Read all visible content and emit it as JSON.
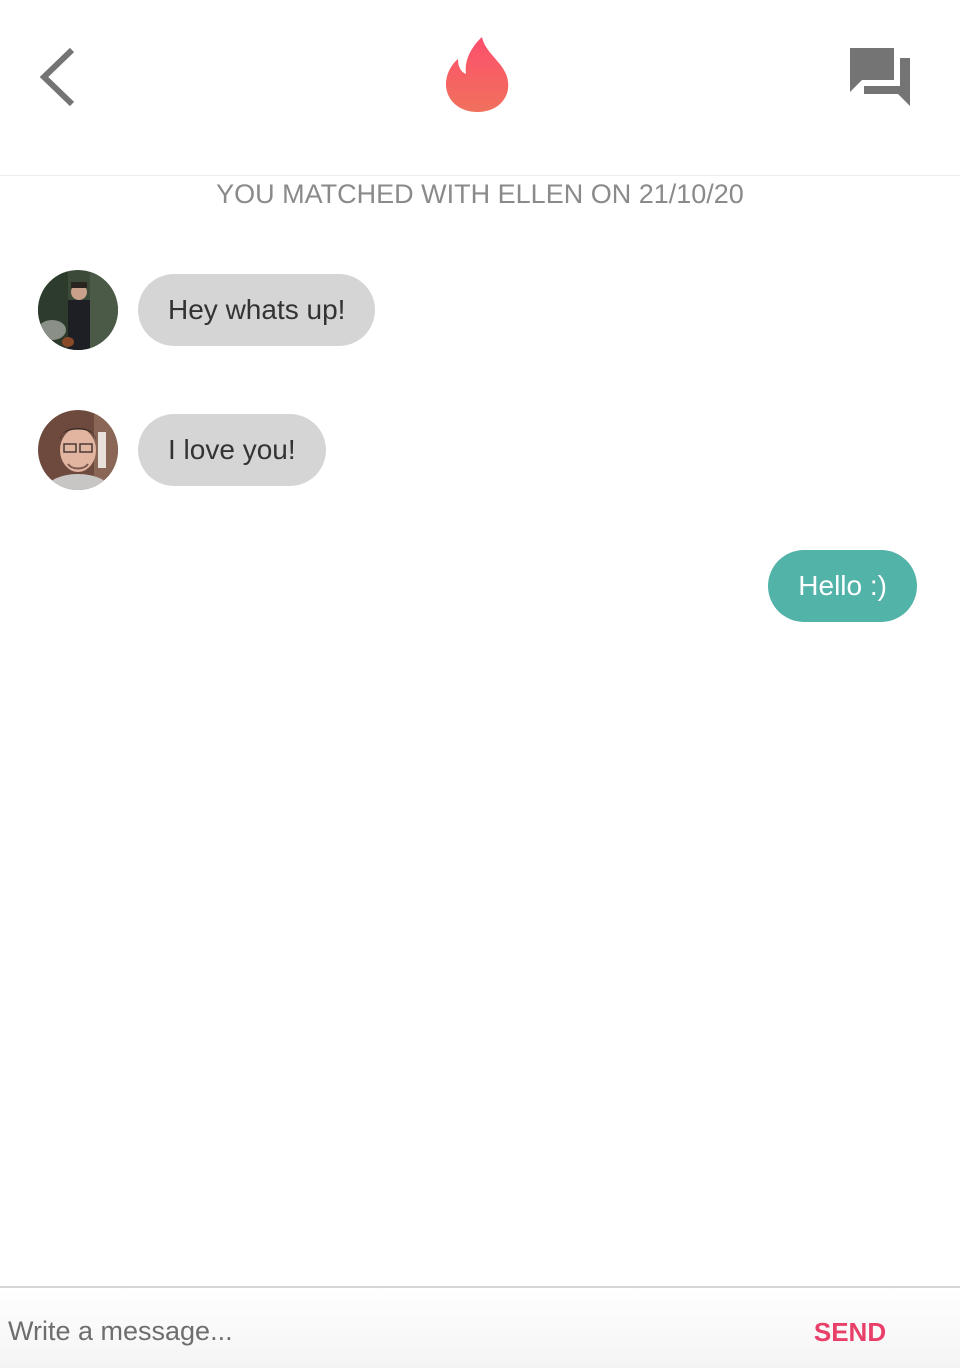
{
  "header": {
    "back_icon": "chevron-left-icon",
    "logo_icon": "flame-icon",
    "chats_icon": "chat-bubbles-icon",
    "colors": {
      "icon_gray": "#747474",
      "flame_top": "#fd5564",
      "flame_bottom": "#ef6b5a"
    }
  },
  "match_banner": "YOU MATCHED WITH ELLEN ON 21/10/20",
  "messages": [
    {
      "direction": "incoming",
      "text": "Hey whats up!"
    },
    {
      "direction": "incoming",
      "text": "I love you!"
    },
    {
      "direction": "outgoing",
      "text": "Hello :)"
    }
  ],
  "composer": {
    "placeholder": "Write a message...",
    "value": "",
    "send_label": "SEND"
  },
  "colors": {
    "incoming_bubble": "#d5d5d5",
    "outgoing_bubble": "#52b3a9",
    "send_text": "#e9406a",
    "banner_text": "#8a8a8a"
  }
}
